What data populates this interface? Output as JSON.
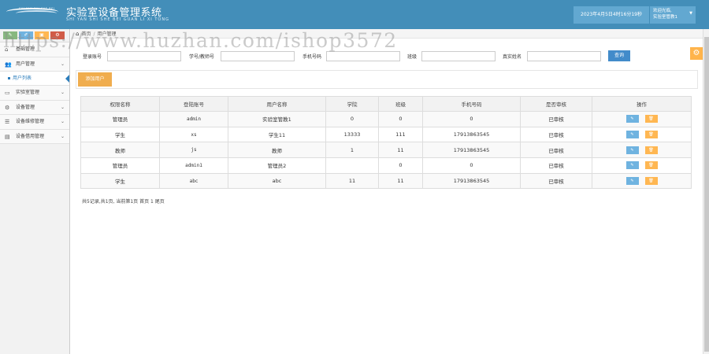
{
  "header": {
    "logo_text": "SHI YAN SHI SHE BEI",
    "title": "实验室设备管理系统",
    "subtitle": "SHI YAN SHI SHE BEI GUAN LI XI TONG",
    "datetime": "2023年4月5日4时16分19秒",
    "welcome": "欢迎光临,",
    "username": "实验室管教1"
  },
  "sidebar": {
    "shortcuts": [
      "✎",
      "✐",
      "▣",
      "⚙"
    ],
    "items": [
      {
        "label": "基础管理",
        "icon": "home-icon"
      },
      {
        "label": "用户管理",
        "icon": "users-icon",
        "expanded": true
      },
      {
        "label": "实验室管理",
        "icon": "monitor-icon"
      },
      {
        "label": "设备管理",
        "icon": "cogs-icon"
      },
      {
        "label": "设备维修管理",
        "icon": "list-icon"
      },
      {
        "label": "设备借用管理",
        "icon": "book-icon"
      }
    ],
    "sub_item": "用户列表"
  },
  "breadcrumb": {
    "home": "首页",
    "current": "用户管理"
  },
  "search": {
    "login_label": "登录账号",
    "student_id_label": "学号/教师号",
    "phone_label": "手机号码",
    "class_label": "班级",
    "real_name_label": "真实姓名",
    "query_button": "查询"
  },
  "add_button": "添加用户",
  "table": {
    "headers": [
      "权限名称",
      "登陆账号",
      "用户名称",
      "学院",
      "班级",
      "手机号码",
      "是否审核",
      "操作"
    ],
    "rows": [
      [
        "管理员",
        "admin",
        "实验室管教1",
        "0",
        "0",
        "0",
        "已审核"
      ],
      [
        "学生",
        "xs",
        "学生11",
        "13333",
        "111",
        "17913863545",
        "已审核"
      ],
      [
        "教师",
        "js",
        "教师",
        "1",
        "11",
        "17913863545",
        "已审核"
      ],
      [
        "管理员",
        "admin1",
        "管理员2",
        "",
        "0",
        "0",
        "已审核"
      ],
      [
        "学生",
        "abc",
        "abc",
        "11",
        "11",
        "17913863545",
        "已审核"
      ]
    ],
    "edit_icon": "edit-icon",
    "delete_icon": "trash-icon"
  },
  "pager": "共5记录,共1页, 当前第1页 首页 1 尾页",
  "watermark": "https://www.huzhan.com/ishop3572"
}
